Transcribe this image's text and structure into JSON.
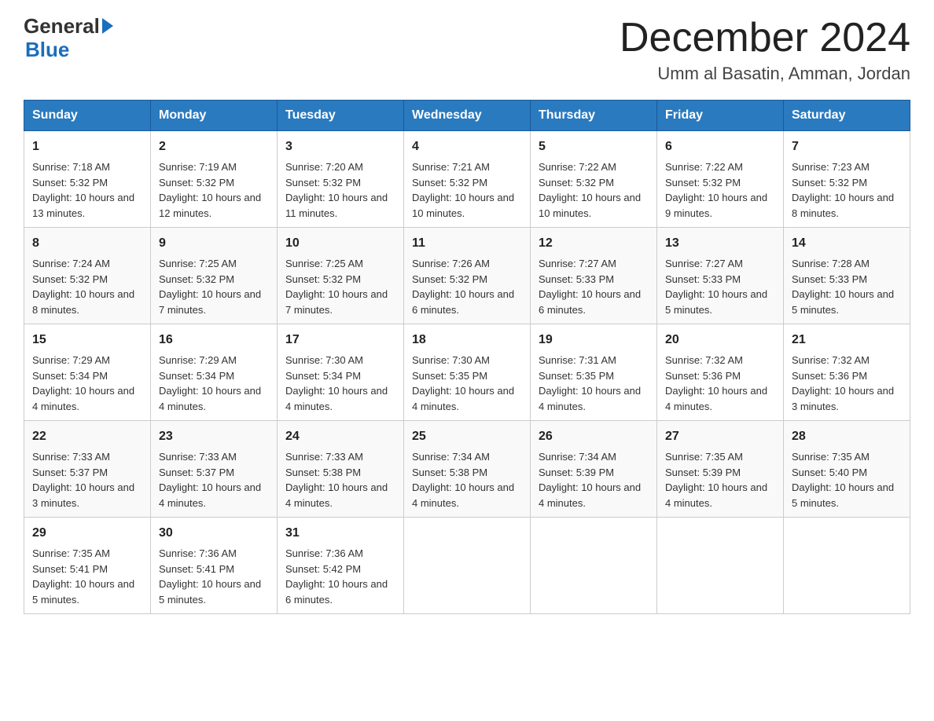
{
  "header": {
    "logo": {
      "general": "General",
      "blue": "Blue"
    },
    "title": "December 2024",
    "subtitle": "Umm al Basatin, Amman, Jordan"
  },
  "days_of_week": [
    "Sunday",
    "Monday",
    "Tuesday",
    "Wednesday",
    "Thursday",
    "Friday",
    "Saturday"
  ],
  "weeks": [
    [
      {
        "day": "1",
        "sunrise": "7:18 AM",
        "sunset": "5:32 PM",
        "daylight": "10 hours and 13 minutes."
      },
      {
        "day": "2",
        "sunrise": "7:19 AM",
        "sunset": "5:32 PM",
        "daylight": "10 hours and 12 minutes."
      },
      {
        "day": "3",
        "sunrise": "7:20 AM",
        "sunset": "5:32 PM",
        "daylight": "10 hours and 11 minutes."
      },
      {
        "day": "4",
        "sunrise": "7:21 AM",
        "sunset": "5:32 PM",
        "daylight": "10 hours and 10 minutes."
      },
      {
        "day": "5",
        "sunrise": "7:22 AM",
        "sunset": "5:32 PM",
        "daylight": "10 hours and 10 minutes."
      },
      {
        "day": "6",
        "sunrise": "7:22 AM",
        "sunset": "5:32 PM",
        "daylight": "10 hours and 9 minutes."
      },
      {
        "day": "7",
        "sunrise": "7:23 AM",
        "sunset": "5:32 PM",
        "daylight": "10 hours and 8 minutes."
      }
    ],
    [
      {
        "day": "8",
        "sunrise": "7:24 AM",
        "sunset": "5:32 PM",
        "daylight": "10 hours and 8 minutes."
      },
      {
        "day": "9",
        "sunrise": "7:25 AM",
        "sunset": "5:32 PM",
        "daylight": "10 hours and 7 minutes."
      },
      {
        "day": "10",
        "sunrise": "7:25 AM",
        "sunset": "5:32 PM",
        "daylight": "10 hours and 7 minutes."
      },
      {
        "day": "11",
        "sunrise": "7:26 AM",
        "sunset": "5:32 PM",
        "daylight": "10 hours and 6 minutes."
      },
      {
        "day": "12",
        "sunrise": "7:27 AM",
        "sunset": "5:33 PM",
        "daylight": "10 hours and 6 minutes."
      },
      {
        "day": "13",
        "sunrise": "7:27 AM",
        "sunset": "5:33 PM",
        "daylight": "10 hours and 5 minutes."
      },
      {
        "day": "14",
        "sunrise": "7:28 AM",
        "sunset": "5:33 PM",
        "daylight": "10 hours and 5 minutes."
      }
    ],
    [
      {
        "day": "15",
        "sunrise": "7:29 AM",
        "sunset": "5:34 PM",
        "daylight": "10 hours and 4 minutes."
      },
      {
        "day": "16",
        "sunrise": "7:29 AM",
        "sunset": "5:34 PM",
        "daylight": "10 hours and 4 minutes."
      },
      {
        "day": "17",
        "sunrise": "7:30 AM",
        "sunset": "5:34 PM",
        "daylight": "10 hours and 4 minutes."
      },
      {
        "day": "18",
        "sunrise": "7:30 AM",
        "sunset": "5:35 PM",
        "daylight": "10 hours and 4 minutes."
      },
      {
        "day": "19",
        "sunrise": "7:31 AM",
        "sunset": "5:35 PM",
        "daylight": "10 hours and 4 minutes."
      },
      {
        "day": "20",
        "sunrise": "7:32 AM",
        "sunset": "5:36 PM",
        "daylight": "10 hours and 4 minutes."
      },
      {
        "day": "21",
        "sunrise": "7:32 AM",
        "sunset": "5:36 PM",
        "daylight": "10 hours and 3 minutes."
      }
    ],
    [
      {
        "day": "22",
        "sunrise": "7:33 AM",
        "sunset": "5:37 PM",
        "daylight": "10 hours and 3 minutes."
      },
      {
        "day": "23",
        "sunrise": "7:33 AM",
        "sunset": "5:37 PM",
        "daylight": "10 hours and 4 minutes."
      },
      {
        "day": "24",
        "sunrise": "7:33 AM",
        "sunset": "5:38 PM",
        "daylight": "10 hours and 4 minutes."
      },
      {
        "day": "25",
        "sunrise": "7:34 AM",
        "sunset": "5:38 PM",
        "daylight": "10 hours and 4 minutes."
      },
      {
        "day": "26",
        "sunrise": "7:34 AM",
        "sunset": "5:39 PM",
        "daylight": "10 hours and 4 minutes."
      },
      {
        "day": "27",
        "sunrise": "7:35 AM",
        "sunset": "5:39 PM",
        "daylight": "10 hours and 4 minutes."
      },
      {
        "day": "28",
        "sunrise": "7:35 AM",
        "sunset": "5:40 PM",
        "daylight": "10 hours and 5 minutes."
      }
    ],
    [
      {
        "day": "29",
        "sunrise": "7:35 AM",
        "sunset": "5:41 PM",
        "daylight": "10 hours and 5 minutes."
      },
      {
        "day": "30",
        "sunrise": "7:36 AM",
        "sunset": "5:41 PM",
        "daylight": "10 hours and 5 minutes."
      },
      {
        "day": "31",
        "sunrise": "7:36 AM",
        "sunset": "5:42 PM",
        "daylight": "10 hours and 6 minutes."
      },
      null,
      null,
      null,
      null
    ]
  ],
  "labels": {
    "sunrise": "Sunrise:",
    "sunset": "Sunset:",
    "daylight": "Daylight:"
  }
}
